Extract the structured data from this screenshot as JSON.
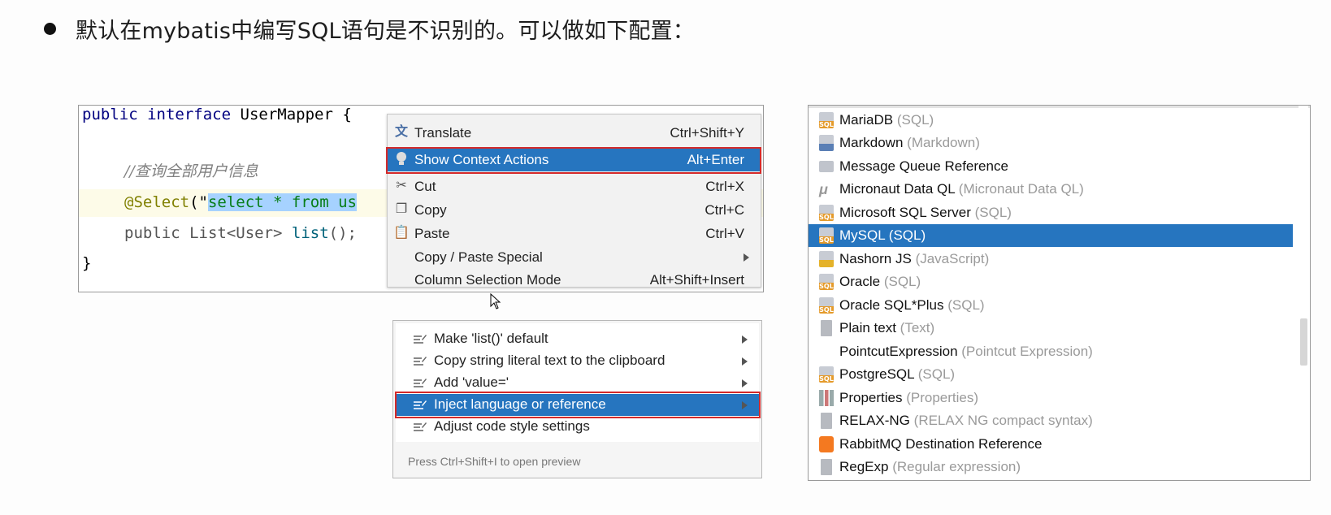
{
  "heading": "默认在mybatis中编写SQL语句是不识别的。可以做如下配置：",
  "code": {
    "line1_kw1": "public",
    "line1_kw2": "interface",
    "line1_name": "UserMapper",
    "line1_brace": "{",
    "line2_comment": "//查询全部用户信息",
    "line3_ann": "@Select",
    "line3_paren": "(\"",
    "line3_str": "select * from us",
    "line4_text": "public List<User> ",
    "line4_fn": "list",
    "line4_tail": "();",
    "line5": "}"
  },
  "context_menu": {
    "items": [
      {
        "label": "Translate",
        "shortcut": "Ctrl+Shift+Y",
        "icon": "translate-icon"
      },
      {
        "label": "Show Context Actions",
        "shortcut": "Alt+Enter",
        "icon": "bulb-icon"
      },
      {
        "label": "Cut",
        "shortcut": "Ctrl+X",
        "icon": "scissors-icon"
      },
      {
        "label": "Copy",
        "shortcut": "Ctrl+C",
        "icon": "copy-icon"
      },
      {
        "label": "Paste",
        "shortcut": "Ctrl+V",
        "icon": "paste-icon"
      },
      {
        "label": "Copy / Paste Special",
        "shortcut": "",
        "icon": ""
      },
      {
        "label": "Column Selection Mode",
        "shortcut": "Alt+Shift+Insert",
        "icon": ""
      }
    ]
  },
  "intention_menu": {
    "items": [
      {
        "label": "Make 'list()' default"
      },
      {
        "label": "Copy string literal text to the clipboard"
      },
      {
        "label": "Add 'value='"
      },
      {
        "label": "Inject language or reference"
      },
      {
        "label": "Adjust code style settings"
      }
    ],
    "hint": "Press Ctrl+Shift+I to open preview"
  },
  "language_list": {
    "items": [
      {
        "name": "MariaDB",
        "sub": "(SQL)",
        "icon": "sql-icon"
      },
      {
        "name": "Markdown",
        "sub": "(Markdown)",
        "icon": "markdown-icon"
      },
      {
        "name": "Message Queue Reference",
        "sub": "",
        "icon": "message-icon"
      },
      {
        "name": "Micronaut Data QL",
        "sub": "(Micronaut Data QL)",
        "icon": "micronaut-icon"
      },
      {
        "name": "Microsoft SQL Server",
        "sub": "(SQL)",
        "icon": "sql-icon"
      },
      {
        "name": "MySQL",
        "sub": "(SQL)",
        "icon": "sql-icon"
      },
      {
        "name": "Nashorn JS",
        "sub": "(JavaScript)",
        "icon": "js-icon"
      },
      {
        "name": "Oracle",
        "sub": "(SQL)",
        "icon": "sql-icon"
      },
      {
        "name": "Oracle SQL*Plus",
        "sub": "(SQL)",
        "icon": "sql-icon"
      },
      {
        "name": "Plain text",
        "sub": "(Text)",
        "icon": "text-file-icon"
      },
      {
        "name": "PointcutExpression",
        "sub": "(Pointcut Expression)",
        "icon": ""
      },
      {
        "name": "PostgreSQL",
        "sub": "(SQL)",
        "icon": "sql-icon"
      },
      {
        "name": "Properties",
        "sub": "(Properties)",
        "icon": "properties-icon"
      },
      {
        "name": "RELAX-NG",
        "sub": "(RELAX NG compact syntax)",
        "icon": "text-file-icon"
      },
      {
        "name": "RabbitMQ Destination Reference",
        "sub": "",
        "icon": "rabbitmq-icon"
      },
      {
        "name": "RegExp",
        "sub": "(Regular expression)",
        "icon": "regexp-icon"
      }
    ],
    "selected": "MySQL"
  },
  "colors": {
    "selection": "#2675bf",
    "highlight_box": "#d42a2a",
    "keyword": "#000080",
    "string": "#067d17"
  }
}
